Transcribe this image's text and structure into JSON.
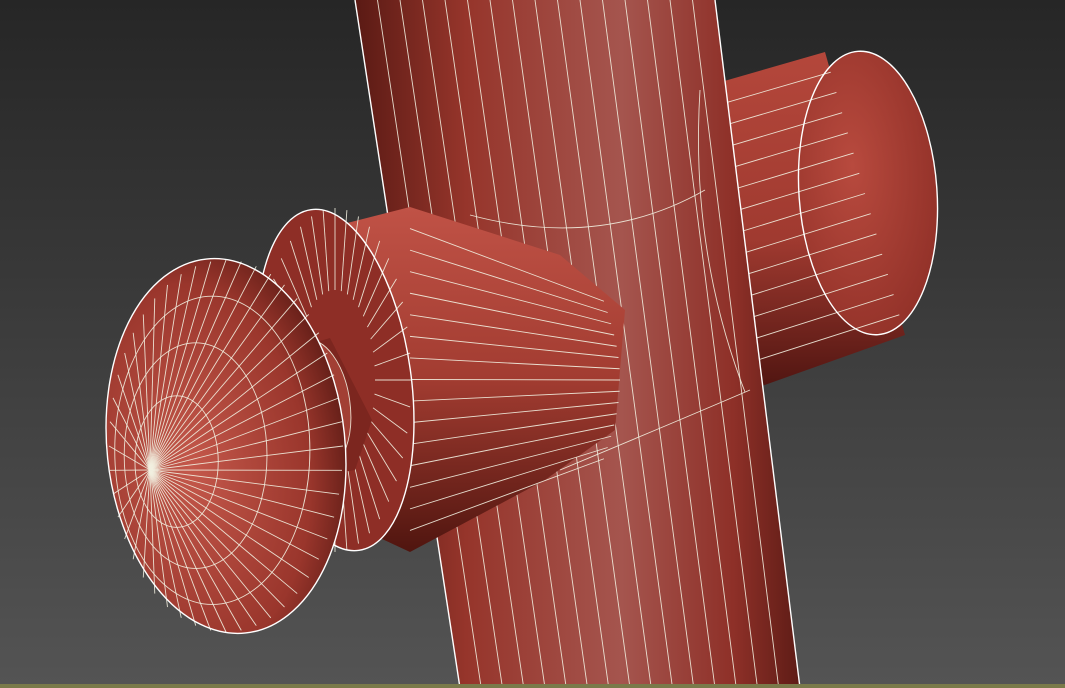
{
  "viewport": {
    "colors": {
      "background_top": "#262626",
      "background_bottom": "#545454",
      "mesh_dark": "#5a1a14",
      "mesh_mid": "#9c3a30",
      "mesh_light": "#c0584a",
      "wireframe": "#f2efe0",
      "bottom_border": "#7a7a4a"
    }
  }
}
